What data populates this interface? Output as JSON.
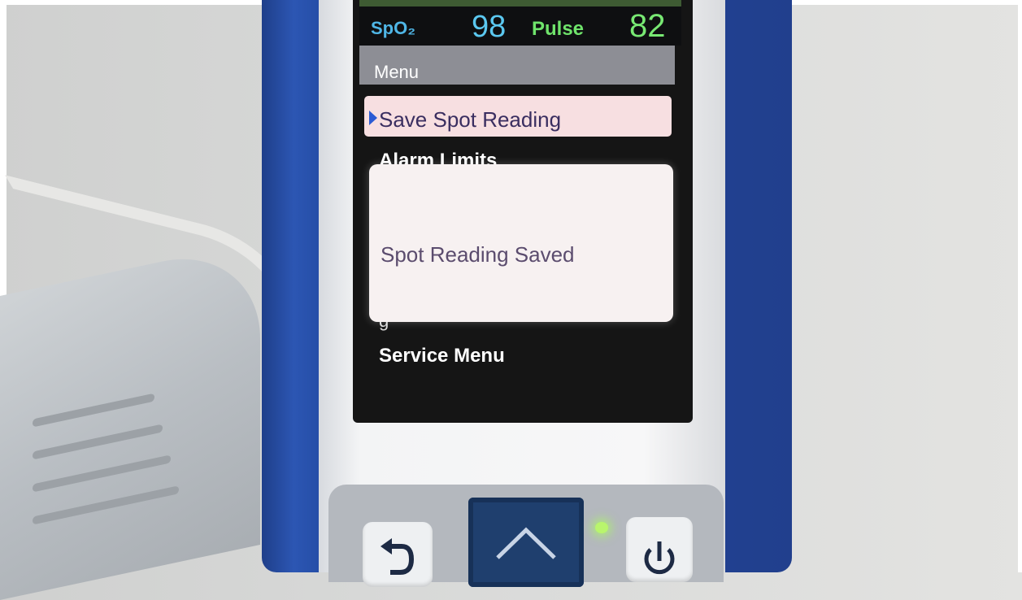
{
  "vitals": {
    "spo2_label": "SpO₂",
    "spo2_value": "98",
    "pulse_label": "Pulse",
    "pulse_value": "82"
  },
  "menu": {
    "title": "Menu",
    "items": [
      {
        "label": "Save Spot Reading",
        "selected": true
      },
      {
        "label": "Alarm Limits"
      },
      {
        "label": "Service Menu"
      }
    ],
    "partially_hidden_text": "g"
  },
  "popup": {
    "message": "Spot Reading Saved"
  },
  "keypad": {
    "buttons": [
      "back-icon",
      "up-arrow-icon",
      "power-icon"
    ],
    "led_color": "#b9f56d"
  },
  "colors": {
    "spo2": "#5bc8f0",
    "pulse": "#78e873",
    "selection": "#f7dfe1",
    "device_blue": "#213f8d"
  }
}
